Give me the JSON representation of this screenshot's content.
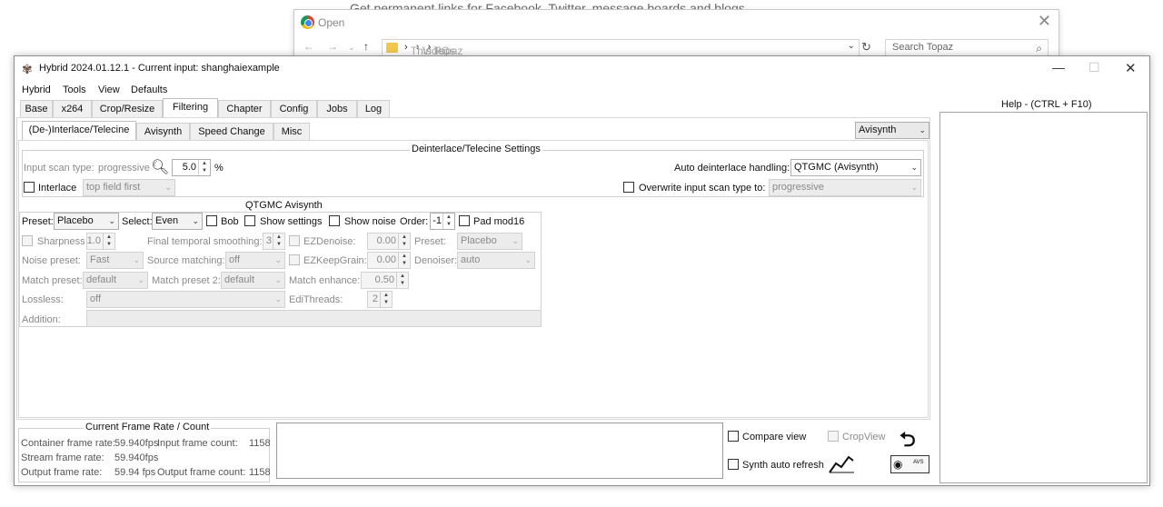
{
  "background": {
    "browser_text": "Get permanent links for Facebook, Twitter, message boards and blogs",
    "open_dialog": {
      "title": "Open",
      "path": [
        "This PC",
        "Videos",
        "Topaz"
      ],
      "search_placeholder": "Search Topaz"
    }
  },
  "window": {
    "title": "Hybrid 2024.01.12.1 - Current input: shanghaiexample",
    "menu": [
      "Hybrid",
      "Tools",
      "View",
      "Defaults"
    ],
    "main_tabs": [
      "Base",
      "x264",
      "Crop/Resize",
      "Filtering",
      "Chapter",
      "Config",
      "Jobs",
      "Log"
    ],
    "active_main_tab": "Filtering",
    "sub_tabs": [
      "(De-)Interlace/Telecine",
      "Avisynth",
      "Speed Change",
      "Misc"
    ],
    "active_sub_tab": "(De-)Interlace/Telecine",
    "engine_select": "Avisynth",
    "help_title": "Help - (CTRL + F10)"
  },
  "deinterlace": {
    "group_title": "Deinterlace/Telecine Settings",
    "input_scan_label": "Input scan type:",
    "input_scan_value": "progressive",
    "percent_value": "5.0",
    "percent_unit": "%",
    "interlace_label": "Interlace",
    "field_order": "top field first",
    "auto_handling_label": "Auto deinterlace handling:",
    "auto_handling_value": "QTGMC (Avisynth)",
    "overwrite_label": "Overwrite input scan type to:",
    "overwrite_value": "progressive"
  },
  "qtgmc": {
    "group_title": "QTGMC Avisynth",
    "preset_label": "Preset:",
    "preset_value": "Placebo",
    "select_label": "Select:",
    "select_value": "Even",
    "bob_label": "Bob",
    "show_settings_label": "Show settings",
    "show_noise_label": "Show noise",
    "order_label": "Order:",
    "order_value": "-1",
    "pad_label": "Pad mod16",
    "sharpness_label": "Sharpness",
    "sharpness_value": "1.0",
    "fts_label": "Final temporal smoothing:",
    "fts_value": "3",
    "ezdenoise_label": "EZDenoise:",
    "ezdenoise_value": "0.00",
    "preset2_label": "Preset:",
    "preset2_value": "Placebo",
    "noise_preset_label": "Noise preset:",
    "noise_preset_value": "Fast",
    "source_matching_label": "Source matching:",
    "source_matching_value": "off",
    "ezkeepgrain_label": "EZKeepGrain:",
    "ezkeepgrain_value": "0.00",
    "denoiser_label": "Denoiser:",
    "denoiser_value": "auto",
    "match_preset_label": "Match preset:",
    "match_preset_value": "default",
    "match_preset2_label": "Match preset 2:",
    "match_preset2_value": "default",
    "match_enhance_label": "Match enhance:",
    "match_enhance_value": "0.50",
    "lossless_label": "Lossless:",
    "lossless_value": "off",
    "edithreads_label": "EdiThreads:",
    "edithreads_value": "2",
    "addition_label": "Addition:"
  },
  "frame_rate": {
    "group_title": "Current Frame Rate / Count",
    "container_label": "Container frame rate:",
    "container_value": "59.940fps",
    "input_count_label": "Input frame count:",
    "input_count_value": "1158",
    "stream_label": "Stream frame rate:",
    "stream_value": "59.940fps",
    "output_label": "Output frame rate:",
    "output_value": "59.94 fps",
    "output_count_label": "Output frame count:",
    "output_count_value": "1158"
  },
  "bottom": {
    "compare_view_label": "Compare view",
    "crop_view_label": "CropView",
    "synth_refresh_label": "Synth auto refresh",
    "avs_badge": "AVS"
  }
}
